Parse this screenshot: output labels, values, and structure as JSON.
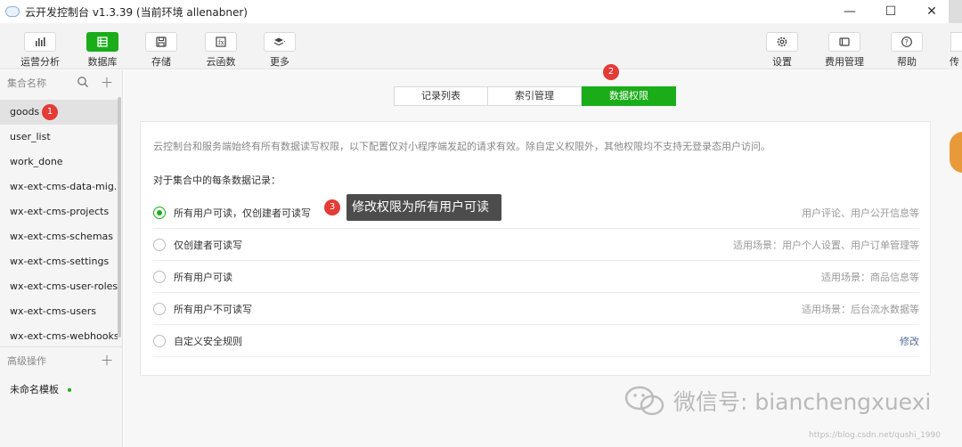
{
  "window": {
    "title": "云开发控制台 v1.3.39 (当前环境 allenabner)"
  },
  "toolbar": {
    "left": [
      {
        "label": "运营分析",
        "icon": "bar-chart-icon",
        "active": false
      },
      {
        "label": "数据库",
        "icon": "database-icon",
        "active": true
      },
      {
        "label": "存储",
        "icon": "storage-icon",
        "active": false
      },
      {
        "label": "云函数",
        "icon": "function-icon",
        "active": false
      },
      {
        "label": "更多",
        "icon": "layers-icon",
        "active": false
      }
    ],
    "right": [
      {
        "label": "设置",
        "icon": "gear-icon"
      },
      {
        "label": "费用管理",
        "icon": "billing-icon"
      },
      {
        "label": "帮助",
        "icon": "help-icon"
      }
    ],
    "cut_label": "传"
  },
  "sidebar": {
    "header": "集合名称",
    "collections": [
      "goods",
      "user_list",
      "work_done",
      "wx-ext-cms-data-mig...",
      "wx-ext-cms-projects",
      "wx-ext-cms-schemas",
      "wx-ext-cms-settings",
      "wx-ext-cms-user-roles",
      "wx-ext-cms-users",
      "wx-ext-cms-webhooks"
    ],
    "selected": "goods",
    "advanced_header": "高级操作",
    "templates": [
      "未命名模板"
    ]
  },
  "tabs": [
    "记录列表",
    "索引管理",
    "数据权限"
  ],
  "active_tab": "数据权限",
  "permissions": {
    "intro": "云控制台和服务端始终有所有数据读写权限，以下配置仅对小程序端发起的请求有效。除自定义权限外，其他权限均不支持无登录态用户访问。",
    "subheading": "对于集合中的每条数据记录：",
    "options": [
      {
        "label": "所有用户可读，仅创建者可读写",
        "desc": "用户评论、用户公开信息等",
        "checked": true
      },
      {
        "label": "仅创建者可读写",
        "desc": "适用场景：用户个人设置、用户订单管理等",
        "checked": false
      },
      {
        "label": "所有用户可读",
        "desc": "适用场景：商品信息等",
        "checked": false
      },
      {
        "label": "所有用户不可读写",
        "desc": "适用场景：后台流水数据等",
        "checked": false
      },
      {
        "label": "自定义安全规则",
        "desc": "修改",
        "checked": false,
        "desc_is_link": true
      }
    ]
  },
  "annotations": {
    "badge1": "1",
    "badge2": "2",
    "badge3": "3",
    "tooltip": "修改权限为所有用户可读"
  },
  "watermark": {
    "text": "微信号: bianchengxuexi",
    "url": "https://blog.csdn.net/qushi_1990"
  },
  "colors": {
    "accent": "#1aad19",
    "badge": "#e33b36",
    "link": "#576b95"
  }
}
